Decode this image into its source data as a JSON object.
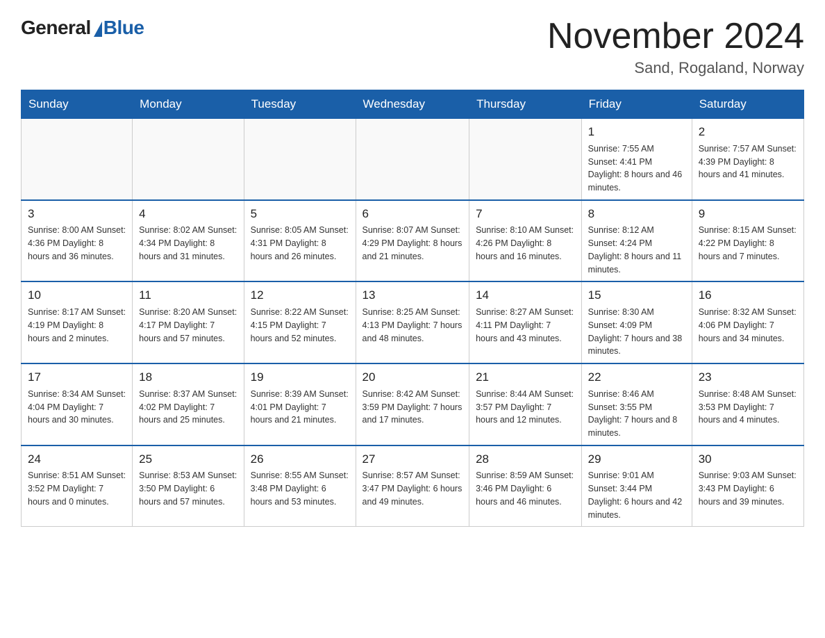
{
  "header": {
    "logo_general": "General",
    "logo_blue": "Blue",
    "month_year": "November 2024",
    "location": "Sand, Rogaland, Norway"
  },
  "days_of_week": [
    "Sunday",
    "Monday",
    "Tuesday",
    "Wednesday",
    "Thursday",
    "Friday",
    "Saturday"
  ],
  "weeks": [
    [
      {
        "day": "",
        "info": ""
      },
      {
        "day": "",
        "info": ""
      },
      {
        "day": "",
        "info": ""
      },
      {
        "day": "",
        "info": ""
      },
      {
        "day": "",
        "info": ""
      },
      {
        "day": "1",
        "info": "Sunrise: 7:55 AM\nSunset: 4:41 PM\nDaylight: 8 hours and 46 minutes."
      },
      {
        "day": "2",
        "info": "Sunrise: 7:57 AM\nSunset: 4:39 PM\nDaylight: 8 hours and 41 minutes."
      }
    ],
    [
      {
        "day": "3",
        "info": "Sunrise: 8:00 AM\nSunset: 4:36 PM\nDaylight: 8 hours and 36 minutes."
      },
      {
        "day": "4",
        "info": "Sunrise: 8:02 AM\nSunset: 4:34 PM\nDaylight: 8 hours and 31 minutes."
      },
      {
        "day": "5",
        "info": "Sunrise: 8:05 AM\nSunset: 4:31 PM\nDaylight: 8 hours and 26 minutes."
      },
      {
        "day": "6",
        "info": "Sunrise: 8:07 AM\nSunset: 4:29 PM\nDaylight: 8 hours and 21 minutes."
      },
      {
        "day": "7",
        "info": "Sunrise: 8:10 AM\nSunset: 4:26 PM\nDaylight: 8 hours and 16 minutes."
      },
      {
        "day": "8",
        "info": "Sunrise: 8:12 AM\nSunset: 4:24 PM\nDaylight: 8 hours and 11 minutes."
      },
      {
        "day": "9",
        "info": "Sunrise: 8:15 AM\nSunset: 4:22 PM\nDaylight: 8 hours and 7 minutes."
      }
    ],
    [
      {
        "day": "10",
        "info": "Sunrise: 8:17 AM\nSunset: 4:19 PM\nDaylight: 8 hours and 2 minutes."
      },
      {
        "day": "11",
        "info": "Sunrise: 8:20 AM\nSunset: 4:17 PM\nDaylight: 7 hours and 57 minutes."
      },
      {
        "day": "12",
        "info": "Sunrise: 8:22 AM\nSunset: 4:15 PM\nDaylight: 7 hours and 52 minutes."
      },
      {
        "day": "13",
        "info": "Sunrise: 8:25 AM\nSunset: 4:13 PM\nDaylight: 7 hours and 48 minutes."
      },
      {
        "day": "14",
        "info": "Sunrise: 8:27 AM\nSunset: 4:11 PM\nDaylight: 7 hours and 43 minutes."
      },
      {
        "day": "15",
        "info": "Sunrise: 8:30 AM\nSunset: 4:09 PM\nDaylight: 7 hours and 38 minutes."
      },
      {
        "day": "16",
        "info": "Sunrise: 8:32 AM\nSunset: 4:06 PM\nDaylight: 7 hours and 34 minutes."
      }
    ],
    [
      {
        "day": "17",
        "info": "Sunrise: 8:34 AM\nSunset: 4:04 PM\nDaylight: 7 hours and 30 minutes."
      },
      {
        "day": "18",
        "info": "Sunrise: 8:37 AM\nSunset: 4:02 PM\nDaylight: 7 hours and 25 minutes."
      },
      {
        "day": "19",
        "info": "Sunrise: 8:39 AM\nSunset: 4:01 PM\nDaylight: 7 hours and 21 minutes."
      },
      {
        "day": "20",
        "info": "Sunrise: 8:42 AM\nSunset: 3:59 PM\nDaylight: 7 hours and 17 minutes."
      },
      {
        "day": "21",
        "info": "Sunrise: 8:44 AM\nSunset: 3:57 PM\nDaylight: 7 hours and 12 minutes."
      },
      {
        "day": "22",
        "info": "Sunrise: 8:46 AM\nSunset: 3:55 PM\nDaylight: 7 hours and 8 minutes."
      },
      {
        "day": "23",
        "info": "Sunrise: 8:48 AM\nSunset: 3:53 PM\nDaylight: 7 hours and 4 minutes."
      }
    ],
    [
      {
        "day": "24",
        "info": "Sunrise: 8:51 AM\nSunset: 3:52 PM\nDaylight: 7 hours and 0 minutes."
      },
      {
        "day": "25",
        "info": "Sunrise: 8:53 AM\nSunset: 3:50 PM\nDaylight: 6 hours and 57 minutes."
      },
      {
        "day": "26",
        "info": "Sunrise: 8:55 AM\nSunset: 3:48 PM\nDaylight: 6 hours and 53 minutes."
      },
      {
        "day": "27",
        "info": "Sunrise: 8:57 AM\nSunset: 3:47 PM\nDaylight: 6 hours and 49 minutes."
      },
      {
        "day": "28",
        "info": "Sunrise: 8:59 AM\nSunset: 3:46 PM\nDaylight: 6 hours and 46 minutes."
      },
      {
        "day": "29",
        "info": "Sunrise: 9:01 AM\nSunset: 3:44 PM\nDaylight: 6 hours and 42 minutes."
      },
      {
        "day": "30",
        "info": "Sunrise: 9:03 AM\nSunset: 3:43 PM\nDaylight: 6 hours and 39 minutes."
      }
    ]
  ]
}
